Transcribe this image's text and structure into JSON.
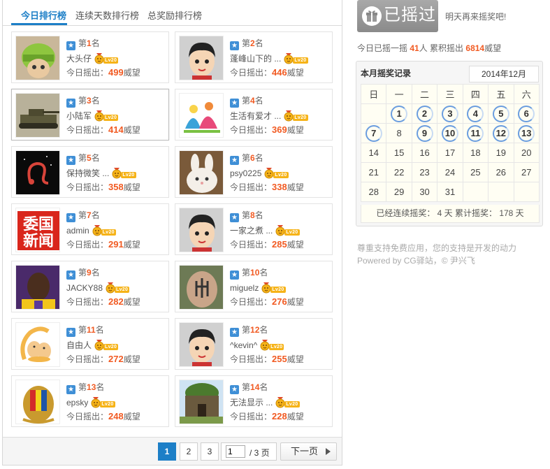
{
  "tabs": [
    {
      "label": "今日排行榜",
      "active": true
    },
    {
      "label": "连续天数排行榜",
      "active": false
    },
    {
      "label": "总奖励排行榜",
      "active": false
    }
  ],
  "rank_prefix": "第",
  "rank_suffix": "名",
  "score_prefix": "今日摇出：",
  "score_unit": "威望",
  "level_badge": "Lv20",
  "ranking": [
    {
      "rank": "1",
      "name": "大头仔",
      "score": "499"
    },
    {
      "rank": "2",
      "name": "蓬峰山下的 ...",
      "score": "446"
    },
    {
      "rank": "3",
      "name": "小陆军",
      "score": "414"
    },
    {
      "rank": "4",
      "name": "生活有爱才 ...",
      "score": "369"
    },
    {
      "rank": "5",
      "name": "保持微笑 ...",
      "score": "358"
    },
    {
      "rank": "6",
      "name": "psy0225",
      "score": "338"
    },
    {
      "rank": "7",
      "name": "admin",
      "score": "291"
    },
    {
      "rank": "8",
      "name": "一家之煮 ...",
      "score": "285"
    },
    {
      "rank": "9",
      "name": "JACKY88",
      "score": "282"
    },
    {
      "rank": "10",
      "name": "miguelz",
      "score": "276"
    },
    {
      "rank": "11",
      "name": "自由人",
      "score": "272"
    },
    {
      "rank": "12",
      "name": "^kevin^",
      "score": "255"
    },
    {
      "rank": "13",
      "name": "epsky",
      "score": "248"
    },
    {
      "rank": "14",
      "name": "无法显示 ...",
      "score": "228"
    }
  ],
  "avatar_text_7": "委国新闻",
  "pager": {
    "pages": [
      "1",
      "2",
      "3"
    ],
    "current": "1",
    "input_value": "1",
    "total": "/ 3 页",
    "next_label": "下一页"
  },
  "shake": {
    "button_label": "已摇过",
    "tomorrow_text": "明天再来摇奖吧!",
    "stats_prefix": "今日已摇一摇",
    "today_count": "41",
    "today_unit": "人 累积摇出",
    "total_score": "6814",
    "total_unit": "威望"
  },
  "calendar": {
    "title": "本月摇奖记录",
    "month": "2014年12月",
    "weekdays": [
      "日",
      "一",
      "二",
      "三",
      "四",
      "五",
      "六"
    ],
    "checked_days": [
      1,
      2,
      3,
      4,
      5,
      6,
      7,
      9,
      10,
      11,
      12,
      13
    ],
    "footer": "已经连续摇奖： 4 天 累计摇奖： 178 天"
  },
  "support": {
    "line1": "尊重支持免费应用，您的支持是开发的动力",
    "line2": "Powered by CG驿站，© 尹兴飞"
  },
  "colors": {
    "accent": "#1d7fc7",
    "highlight": "#f15a22",
    "ring": "#6a9ddf"
  }
}
